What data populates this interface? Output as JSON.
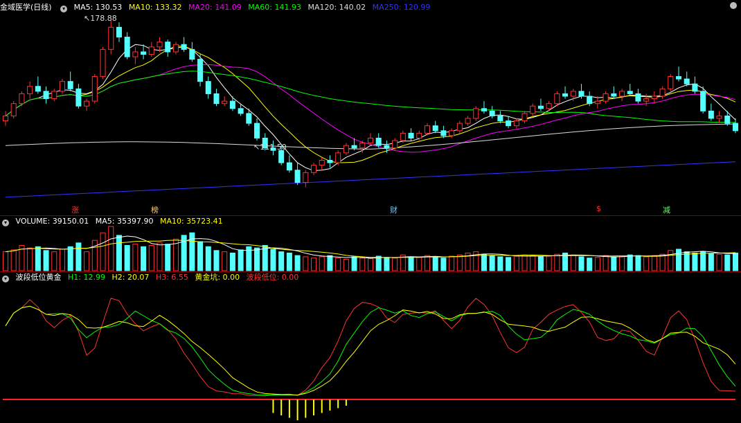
{
  "stock": {
    "name": "金域医学",
    "period": "(日线)"
  },
  "price_legend": [
    {
      "label": "MA5: 130.53",
      "color": "#ffffff"
    },
    {
      "label": "MA10: 133.32",
      "color": "#ffff00"
    },
    {
      "label": "MA20: 141.09",
      "color": "#ff00ff"
    },
    {
      "label": "MA60: 141.93",
      "color": "#00ff00"
    },
    {
      "label": "MA120: 140.02",
      "color": "#dddddd"
    },
    {
      "label": "MA250: 120.99",
      "color": "#3333ff"
    }
  ],
  "price_annotations": {
    "high": "178.88",
    "low": "111.50"
  },
  "event_markers": [
    {
      "label": "涨",
      "color": "#ff3333"
    },
    {
      "label": "榜",
      "color": "#ffcc66"
    },
    {
      "label": "财",
      "color": "#66ccff"
    },
    {
      "label": "$",
      "color": "#ff3333"
    },
    {
      "label": "减",
      "color": "#66ff66"
    }
  ],
  "volume_legend": [
    {
      "label": "VOLUME: 39150.01",
      "color": "#ffffff"
    },
    {
      "label": "MA5: 35397.90",
      "color": "#ffffff"
    },
    {
      "label": "MA10: 35723.41",
      "color": "#ffff00"
    }
  ],
  "indicator": {
    "name": "波段低位黄金",
    "legend": [
      {
        "label": "H1: 12.99",
        "color": "#00ff00"
      },
      {
        "label": "H2: 20.07",
        "color": "#ffff00"
      },
      {
        "label": "H3: 6.55",
        "color": "#ff3333"
      },
      {
        "label": "黄金坑: 0.00",
        "color": "#ffff00"
      },
      {
        "label": "波段低位: 0.00",
        "color": "#ff3333"
      }
    ]
  },
  "colors": {
    "up": "#ff3333",
    "down": "#54ffff",
    "grid": "#8b0000"
  },
  "chart_data": [
    {
      "type": "candlestick",
      "title": "金域医学 (日线)",
      "ylim": [
        105,
        182
      ],
      "series": [
        {
          "name": "price",
          "values": [
            [
              138,
              142,
              136,
              140
            ],
            [
              140,
              146,
              139,
              145
            ],
            [
              145,
              150,
              144,
              149
            ],
            [
              149,
              154,
              147,
              152
            ],
            [
              152,
              156,
              149,
              150
            ],
            [
              150,
              152,
              145,
              147
            ],
            [
              147,
              151,
              146,
              150
            ],
            [
              150,
              155,
              149,
              154
            ],
            [
              154,
              158,
              150,
              151
            ],
            [
              151,
              153,
              143,
              144
            ],
            [
              144,
              147,
              142,
              146
            ],
            [
              146,
              157,
              145,
              156
            ],
            [
              156,
              168,
              155,
              167
            ],
            [
              167,
              179,
              165,
              176
            ],
            [
              176,
              178,
              170,
              172
            ],
            [
              172,
              174,
              163,
              164
            ],
            [
              164,
              168,
              161,
              166
            ],
            [
              166,
              169,
              163,
              165
            ],
            [
              165,
              170,
              164,
              168
            ],
            [
              168,
              172,
              166,
              170
            ],
            [
              170,
              171,
              164,
              166
            ],
            [
              166,
              170,
              165,
              169
            ],
            [
              169,
              172,
              166,
              167
            ],
            [
              167,
              170,
              162,
              163
            ],
            [
              163,
              165,
              152,
              154
            ],
            [
              154,
              156,
              147,
              149
            ],
            [
              149,
              151,
              144,
              145
            ],
            [
              145,
              148,
              144,
              146
            ],
            [
              146,
              148,
              142,
              143
            ],
            [
              143,
              145,
              140,
              141
            ],
            [
              141,
              143,
              136,
              137
            ],
            [
              137,
              139,
              130,
              131
            ],
            [
              131,
              133,
              126,
              127
            ],
            [
              127,
              130,
              124,
              126
            ],
            [
              126,
              128,
              120,
              121
            ],
            [
              121,
              124,
              117,
              118
            ],
            [
              118,
              121,
              112,
              113
            ],
            [
              113,
              118,
              111,
              117
            ],
            [
              117,
              121,
              116,
              120
            ],
            [
              120,
              123,
              118,
              122
            ],
            [
              122,
              124,
              119,
              121
            ],
            [
              121,
              126,
              120,
              125
            ],
            [
              125,
              129,
              124,
              128
            ],
            [
              128,
              131,
              126,
              127
            ],
            [
              127,
              130,
              125,
              129
            ],
            [
              129,
              133,
              128,
              131
            ],
            [
              131,
              133,
              127,
              128
            ],
            [
              128,
              130,
              125,
              127
            ],
            [
              127,
              131,
              126,
              130
            ],
            [
              130,
              134,
              129,
              133
            ],
            [
              133,
              135,
              130,
              131
            ],
            [
              131,
              134,
              130,
              133
            ],
            [
              133,
              137,
              132,
              136
            ],
            [
              136,
              138,
              133,
              134
            ],
            [
              134,
              136,
              131,
              132
            ],
            [
              132,
              135,
              131,
              134
            ],
            [
              134,
              138,
              133,
              137
            ],
            [
              137,
              140,
              136,
              139
            ],
            [
              139,
              144,
              138,
              143
            ],
            [
              143,
              146,
              141,
              142
            ],
            [
              142,
              144,
              139,
              140
            ],
            [
              140,
              142,
              137,
              138
            ],
            [
              138,
              140,
              135,
              136
            ],
            [
              136,
              139,
              135,
              138
            ],
            [
              138,
              142,
              137,
              141
            ],
            [
              141,
              145,
              140,
              144
            ],
            [
              144,
              147,
              142,
              143
            ],
            [
              143,
              146,
              142,
              145
            ],
            [
              145,
              150,
              144,
              149
            ],
            [
              149,
              152,
              147,
              148
            ],
            [
              148,
              151,
              146,
              150
            ],
            [
              150,
              153,
              147,
              148
            ],
            [
              148,
              150,
              144,
              145
            ],
            [
              145,
              148,
              143,
              146
            ],
            [
              146,
              150,
              145,
              149
            ],
            [
              149,
              152,
              147,
              148
            ],
            [
              148,
              151,
              146,
              150
            ],
            [
              150,
              153,
              148,
              149
            ],
            [
              149,
              151,
              145,
              146
            ],
            [
              146,
              149,
              144,
              147
            ],
            [
              147,
              150,
              145,
              148
            ],
            [
              148,
              152,
              147,
              151
            ],
            [
              151,
              157,
              150,
              156
            ],
            [
              156,
              160,
              154,
              155
            ],
            [
              155,
              158,
              152,
              153
            ],
            [
              153,
              156,
              149,
              150
            ],
            [
              150,
              152,
              141,
              142
            ],
            [
              142,
              145,
              138,
              139
            ],
            [
              139,
              142,
              137,
              140
            ],
            [
              140,
              142,
              136,
              137
            ],
            [
              137,
              139,
              133,
              134
            ]
          ]
        }
      ]
    },
    {
      "type": "bar",
      "title": "VOLUME",
      "ylim": [
        0,
        80000
      ],
      "series": [
        {
          "name": "VOLUME",
          "values": [
            30000,
            33000,
            40000,
            36000,
            38000,
            32000,
            30000,
            34000,
            38000,
            44000,
            30000,
            48000,
            60000,
            70000,
            56000,
            40000,
            42000,
            38000,
            40000,
            44000,
            42000,
            50000,
            56000,
            60000,
            46000,
            38000,
            32000,
            30000,
            28000,
            33000,
            38000,
            36000,
            40000,
            34000,
            30000,
            28000,
            24000,
            22000,
            20000,
            22000,
            24000,
            20000,
            18000,
            22000,
            20000,
            19000,
            23000,
            21000,
            20000,
            25000,
            22000,
            21000,
            24000,
            22000,
            20000,
            23000,
            25000,
            28000,
            30000,
            26000,
            24000,
            22000,
            21000,
            23000,
            25000,
            24000,
            22000,
            23000,
            26000,
            28000,
            25000,
            22000,
            20000,
            21000,
            24000,
            22000,
            23000,
            25000,
            24000,
            22000,
            24000,
            26000,
            32000,
            34000,
            30000,
            28000,
            30000,
            27000,
            26000,
            25000,
            28000
          ]
        }
      ]
    }
  ]
}
